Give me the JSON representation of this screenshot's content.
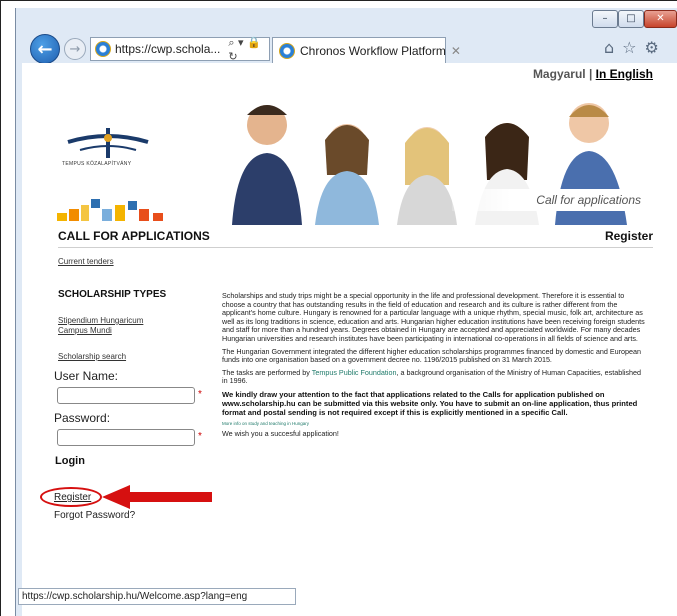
{
  "window": {
    "minimize_glyph": "–",
    "maximize_glyph": "□",
    "close_glyph": "✕"
  },
  "toolbar": {
    "back_glyph": "←",
    "forward_glyph": "→",
    "address": "https://cwp.schola...",
    "address_tools": "⌕ ▾ 🔒 ↻",
    "home_glyph": "⌂",
    "star_glyph": "☆",
    "gear_glyph": "⚙"
  },
  "tab": {
    "label": "Chronos Workflow Platform",
    "close_glyph": "✕"
  },
  "header": {
    "lang_hu": "Magyarul",
    "lang_sep": " | ",
    "lang_en": "In English",
    "logo_text": "TEMPUS KÖZALAPÍTVÁNY",
    "hero_caption": "Call for applications"
  },
  "section": {
    "title": "CALL FOR APPLICATIONS",
    "register": "Register"
  },
  "sidebar": {
    "current_tenders": "Current tenders",
    "types_heading": "SCHOLARSHIP TYPES",
    "type_1": "Stipendium Hungaricum",
    "type_2": "Campus Mundi",
    "search": "Scholarship search"
  },
  "login": {
    "username_label": "User Name:",
    "password_label": "Password:",
    "required_mark": "*",
    "login_label": "Login",
    "register_link": "Register",
    "forgot": "Forgot Password?"
  },
  "content": {
    "p1": "Scholarships and study trips might be a special opportunity in the life and professional development. Therefore it is essential to choose a country that has outstanding results in the field of education and research and its culture is rather different from the applicant's home culture. Hungary is renowned for a particular language with a unique rhythm, special music, folk art, architecture as well as its long traditions in science, education and arts. Hungarian higher education institutions have been receiving foreign students and staff for more than a hundred years. Degrees obtained in Hungary are accepted and appreciated worldwide. For many decades Hungarian universities and research institutes have been participating in international co-operations in all fields of science and arts.",
    "p2": "The Hungarian Government integrated the different higher education scholarships programmes financed by domestic and European funds into one organisation based on a government decree no. 1196/2015 published on 31 March 2015.",
    "p3_a": "The tasks are performed by ",
    "p3_link": "Tempus Public Foundation",
    "p3_b": ", a background organisation of the Ministry of Human Capacities, established in 1996.",
    "p4": "We kindly draw your attention to the fact that applications related to the Calls for application published on www.scholarship.hu can be submitted via this website only. You have to submit an on-line application, thus printed format and postal sending is not required except if this is explicitly mentioned in a specific Call.",
    "more_info": "More info on study and teaching in Hungary",
    "wish": "We wish you a succesful application!"
  },
  "statusbar": {
    "url": "https://cwp.scholarship.hu/Welcome.asp?lang=eng"
  },
  "colors": {
    "annotation_red": "#d61010",
    "accent_green": "#1f7a6a"
  }
}
